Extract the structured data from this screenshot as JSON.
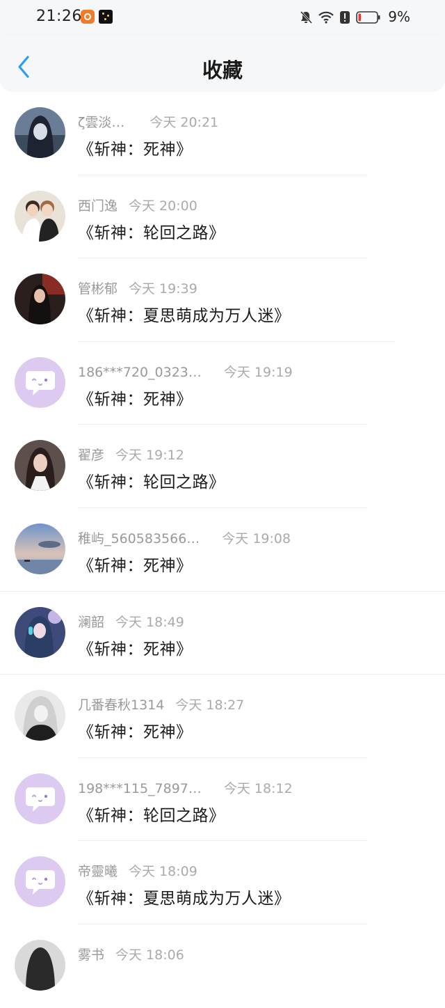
{
  "status_bar": {
    "time": "21:26",
    "battery": "9%",
    "icons": [
      "app-icon",
      "app-icon",
      "mute-bell-icon",
      "wifi-icon",
      "alert-icon",
      "battery-low-icon"
    ]
  },
  "header": {
    "title": "收藏",
    "back_icon": "chevron-left-icon",
    "accent_color": "#2a9df4"
  },
  "items": [
    {
      "name": "ζ雲淡…",
      "time": "今天 20:21",
      "content": "《斩神：死神》",
      "avatar": "photo-dark-hair-girl"
    },
    {
      "name": "西门逸",
      "time": "今天 20:00",
      "content": "《斩神：轮回之路》",
      "avatar": "photo-couple"
    },
    {
      "name": "管彬郁",
      "time": "今天 19:39",
      "content": "《斩神：夏思萌成为万人迷》",
      "avatar": "photo-girl-dark-room"
    },
    {
      "name": "186***720_0323…",
      "time": "今天 19:19",
      "content": "《斩神：死神》",
      "avatar": "default-chat-bubble"
    },
    {
      "name": "翟彦",
      "time": "今天 19:12",
      "content": "《斩神：轮回之路》",
      "avatar": "photo-girl-portrait"
    },
    {
      "name": "稚屿_560583566…",
      "time": "今天 19:08",
      "content": "《斩神：死神》",
      "avatar": "photo-sky-sea"
    },
    {
      "name": "澜韶",
      "time": "今天 18:49",
      "content": "《斩神：死神》",
      "avatar": "photo-anime-headphones"
    },
    {
      "name": "几番春秋1314",
      "time": "今天 18:27",
      "content": "《斩神：死神》",
      "avatar": "photo-anime-white-hair"
    },
    {
      "name": "198***115_7897…",
      "time": "今天 18:12",
      "content": "《斩神：轮回之路》",
      "avatar": "default-chat-bubble"
    },
    {
      "name": "帝靈曦",
      "time": "今天 18:09",
      "content": "《斩神：夏思萌成为万人迷》",
      "avatar": "default-chat-bubble"
    },
    {
      "name": "雾书",
      "time": "今天 18:06",
      "content": "",
      "avatar": "photo-partial"
    }
  ]
}
